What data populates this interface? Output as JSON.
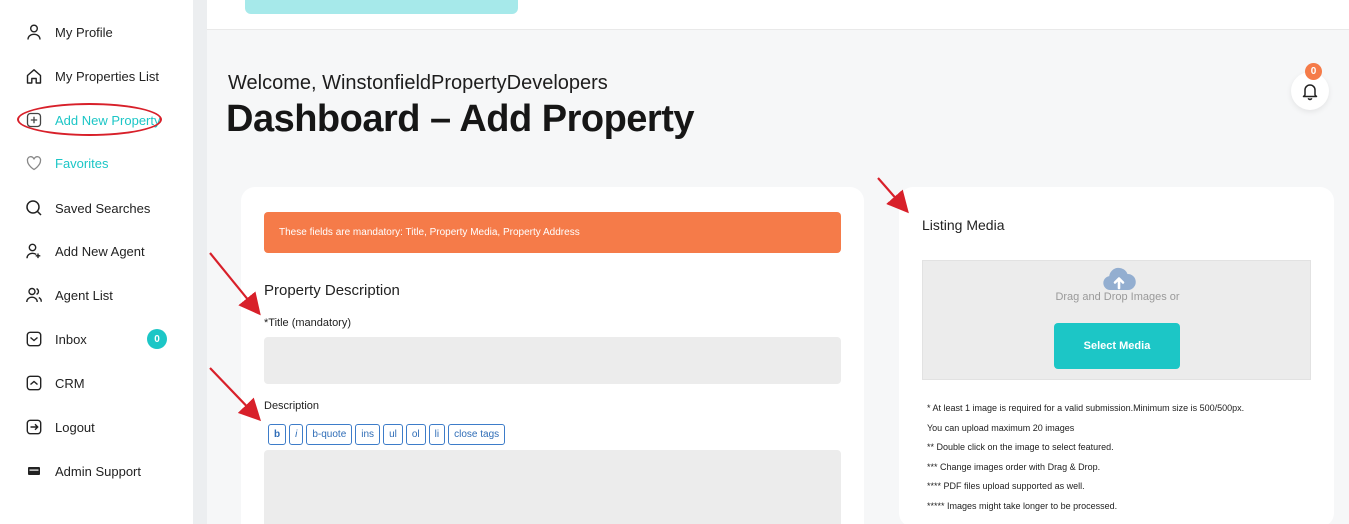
{
  "sidebar": {
    "items": [
      {
        "label": "My Profile",
        "icon": "user-icon"
      },
      {
        "label": "My Properties List",
        "icon": "home-icon"
      },
      {
        "label": "Add New Property",
        "icon": "plus-square-icon"
      },
      {
        "label": "Favorites",
        "icon": "heart-icon"
      },
      {
        "label": "Saved Searches",
        "icon": "search-icon"
      },
      {
        "label": "Add New Agent",
        "icon": "user-plus-icon"
      },
      {
        "label": "Agent List",
        "icon": "users-icon"
      },
      {
        "label": "Inbox",
        "icon": "inbox-icon",
        "badge": "0"
      },
      {
        "label": "CRM",
        "icon": "crm-icon"
      },
      {
        "label": "Logout",
        "icon": "logout-icon"
      },
      {
        "label": "Admin Support",
        "icon": "support-icon"
      }
    ]
  },
  "header": {
    "welcome": "Welcome, WinstonfieldPropertyDevelopers",
    "title": "Dashboard – Add Property",
    "notification_count": "0"
  },
  "form": {
    "alert": "These fields are mandatory: Title, Property Media, Property Address",
    "section_title": "Property Description",
    "title_label": "*Title (mandatory)",
    "title_value": "",
    "description_label": "Description",
    "toolbar": [
      "b",
      "i",
      "b-quote",
      "ins",
      "ul",
      "ol",
      "li",
      "close tags"
    ]
  },
  "media": {
    "title": "Listing Media",
    "drop_text": "Drag and Drop Images or",
    "select_button": "Select Media",
    "notes": [
      "* At least 1 image is required for a valid submission.Minimum size is 500/500px.",
      "You can upload maximum 20 images",
      "** Double click on the image to select featured.",
      "*** Change images order with Drag & Drop.",
      "**** PDF files upload supported as well.",
      "***** Images might take longer to be processed."
    ]
  },
  "colors": {
    "accent": "#1cc6c6",
    "alert": "#f57b49",
    "annotation": "#d8202a"
  }
}
